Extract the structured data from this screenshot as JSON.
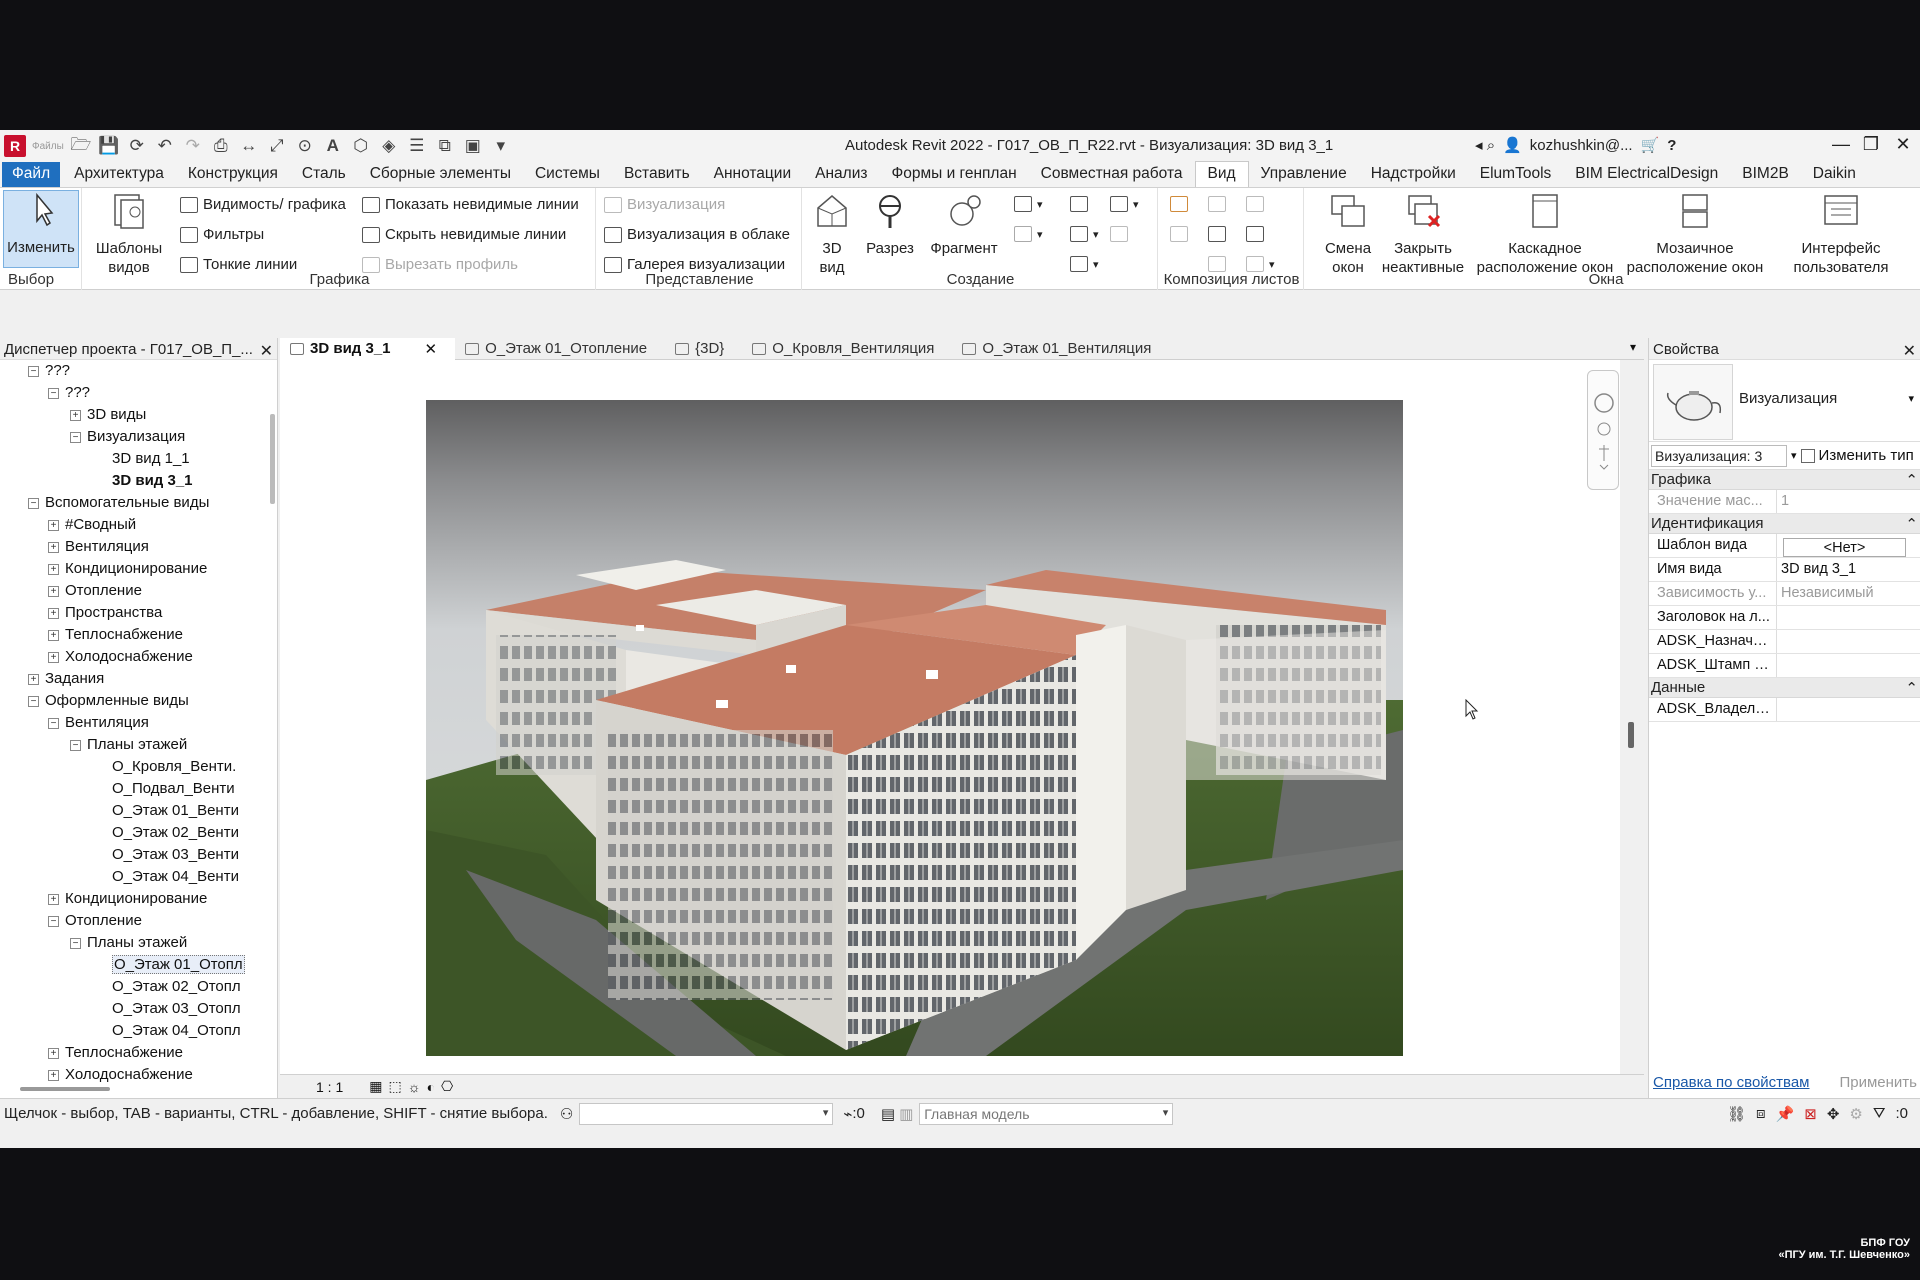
{
  "titlebar": {
    "title": "Autodesk Revit 2022 - Г017_ОВ_П_R22.rvt - Визуализация: 3D вид 3_1",
    "user": "kozhushkin@...",
    "app_icon_label": "R",
    "overlay_text": "Файлы"
  },
  "menu": {
    "tabs": [
      "Файл",
      "Архитектура",
      "Конструкция",
      "Сталь",
      "Сборные элементы",
      "Системы",
      "Вставить",
      "Аннотации",
      "Анализ",
      "Формы и генплан",
      "Совместная работа",
      "Вид",
      "Управление",
      "Надстройки",
      "ElumTools",
      "BIM ElectricalDesign",
      "BIM2B",
      "Daikin"
    ],
    "active": "Вид"
  },
  "ribbon": {
    "select": {
      "button": "Изменить",
      "panel": "Выбор"
    },
    "graphics": {
      "templates_line1": "Шаблоны",
      "templates_line2": "видов",
      "visibility": "Видимость/ графика",
      "filters": "Фильтры",
      "thin_lines": "Тонкие линии",
      "show_hidden": "Показать невидимые линии",
      "hide_hidden": "Скрыть невидимые линии",
      "cut_profile": "Вырезать профиль",
      "panel": "Графика"
    },
    "presentation": {
      "render": "Визуализация",
      "render_cloud": "Визуализация в облаке",
      "gallery": "Галерея визуализации",
      "panel": "Представление"
    },
    "create": {
      "view3d_line1": "3D",
      "view3d_line2": "вид",
      "section": "Разрез",
      "callout": "Фрагмент",
      "panel": "Создание"
    },
    "sheet": {
      "panel": "Композиция листов"
    },
    "windows": {
      "switch_line1": "Смена",
      "switch_line2": "окон",
      "close_line1": "Закрыть",
      "close_line2": "неактивные",
      "cascade_line1": "Каскадное",
      "cascade_line2": "расположение окон",
      "tile_line1": "Мозаичное",
      "tile_line2": "расположение окон",
      "ui_line1": "Интерфейс",
      "ui_line2": "пользователя",
      "panel": "Окна"
    }
  },
  "browser": {
    "title": "Диспетчер проекта - Г017_ОВ_П_...",
    "items": [
      {
        "label": "???",
        "level": 1,
        "exp": "−"
      },
      {
        "label": "???",
        "level": 2,
        "exp": "−"
      },
      {
        "label": "3D виды",
        "level": 3,
        "exp": "+"
      },
      {
        "label": "Визуализация",
        "level": 3,
        "exp": "−"
      },
      {
        "label": "3D вид 1_1",
        "level": 4,
        "exp": ""
      },
      {
        "label": "3D вид 3_1",
        "level": 4,
        "exp": "",
        "bold": true
      },
      {
        "label": "Вспомогательные виды",
        "level": 1,
        "exp": "−"
      },
      {
        "label": "#Сводный",
        "level": 2,
        "exp": "+"
      },
      {
        "label": "Вентиляция",
        "level": 2,
        "exp": "+"
      },
      {
        "label": "Кондиционирование",
        "level": 2,
        "exp": "+"
      },
      {
        "label": "Отопление",
        "level": 2,
        "exp": "+"
      },
      {
        "label": "Пространства",
        "level": 2,
        "exp": "+"
      },
      {
        "label": "Теплоснабжение",
        "level": 2,
        "exp": "+"
      },
      {
        "label": "Холодоснабжение",
        "level": 2,
        "exp": "+"
      },
      {
        "label": "Задания",
        "level": 1,
        "exp": "+"
      },
      {
        "label": "Оформленные виды",
        "level": 1,
        "exp": "−"
      },
      {
        "label": "Вентиляция",
        "level": 2,
        "exp": "−"
      },
      {
        "label": "Планы этажей",
        "level": 3,
        "exp": "−"
      },
      {
        "label": "О_Кровля_Венти.",
        "level": 4,
        "exp": ""
      },
      {
        "label": "О_Подвал_Венти",
        "level": 4,
        "exp": ""
      },
      {
        "label": "О_Этаж 01_Венти",
        "level": 4,
        "exp": ""
      },
      {
        "label": "О_Этаж 02_Венти",
        "level": 4,
        "exp": ""
      },
      {
        "label": "О_Этаж 03_Венти",
        "level": 4,
        "exp": ""
      },
      {
        "label": "О_Этаж 04_Венти",
        "level": 4,
        "exp": ""
      },
      {
        "label": "Кондиционирование",
        "level": 2,
        "exp": "+"
      },
      {
        "label": "Отопление",
        "level": 2,
        "exp": "−"
      },
      {
        "label": "Планы этажей",
        "level": 3,
        "exp": "−"
      },
      {
        "label": "О_Этаж 01_Отопл",
        "level": 4,
        "exp": "",
        "sel": true
      },
      {
        "label": "О_Этаж 02_Отопл",
        "level": 4,
        "exp": ""
      },
      {
        "label": "О_Этаж 03_Отопл",
        "level": 4,
        "exp": ""
      },
      {
        "label": "О_Этаж 04_Отопл",
        "level": 4,
        "exp": ""
      },
      {
        "label": "Теплоснабжение",
        "level": 2,
        "exp": "+"
      },
      {
        "label": "Холодоснабжение",
        "level": 2,
        "exp": "+"
      }
    ]
  },
  "viewtabs": [
    {
      "label": "3D вид 3_1",
      "active": true
    },
    {
      "label": "О_Этаж 01_Отопление"
    },
    {
      "label": "{3D}"
    },
    {
      "label": "О_Кровля_Вентиляция"
    },
    {
      "label": "О_Этаж 01_Вентиляция"
    }
  ],
  "viewcontrol": {
    "scale": "1 : 1"
  },
  "properties": {
    "title": "Свойства",
    "type_name": "Визуализация",
    "instance": "Визуализация: 3",
    "edit_type": "Изменить тип",
    "categories": {
      "graphics": "Графика",
      "identity": "Идентификация",
      "data": "Данные"
    },
    "rows_graphics": [
      {
        "name": "Значение мас...",
        "value": "1",
        "dim": true
      }
    ],
    "rows_identity": [
      {
        "name": "Шаблон вида",
        "value": "<Нет>",
        "box": true
      },
      {
        "name": "Имя вида",
        "value": "3D вид 3_1"
      },
      {
        "name": "Зависимость у...",
        "value": "Независимый",
        "dim": true
      },
      {
        "name": "Заголовок на л...",
        "value": ""
      },
      {
        "name": "ADSK_Назначе...",
        "value": ""
      },
      {
        "name": "ADSK_Штамп Р...",
        "value": ""
      }
    ],
    "rows_data": [
      {
        "name": "ADSK_Владеле...",
        "value": ""
      }
    ],
    "help_link": "Справка по свойствам",
    "apply": "Применить"
  },
  "status": {
    "hint": "Щелчок - выбор, TAB - варианты, CTRL - добавление, SHIFT - снятие выбора.",
    "count": ":0",
    "model": "Главная модель",
    "filter_count": ":0"
  },
  "footer_logo": {
    "line1": "БПФ ГОУ",
    "line2": "«ПГУ им. Т.Г. Шевченко»"
  },
  "colors": {
    "file_tab": "#1f6fbf",
    "roof": "#c47b63",
    "facade": "#ecebe6",
    "grass": "#3f5a2a",
    "sky": "#6f6f6f"
  }
}
